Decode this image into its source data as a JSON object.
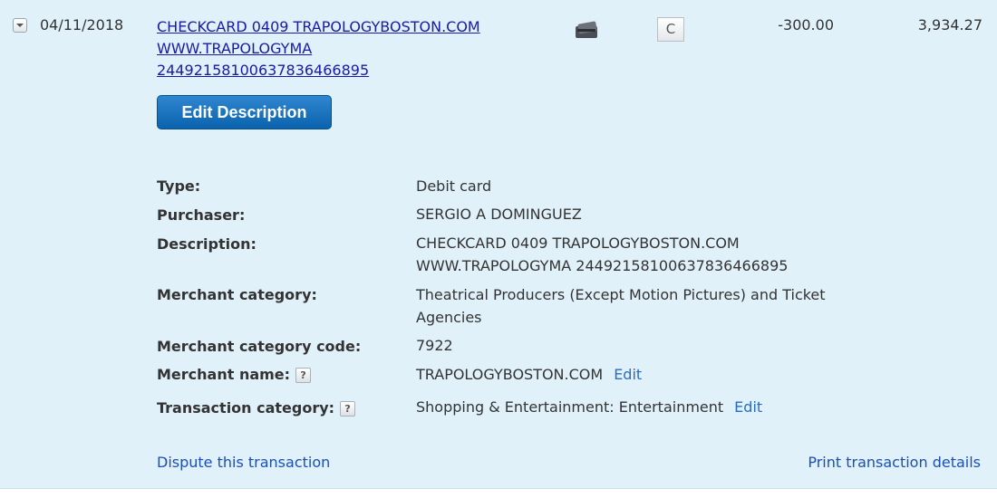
{
  "transaction": {
    "date": "04/11/2018",
    "description_lines": [
      "CHECKCARD 0409 TRAPOLOGYBOSTON.COM",
      "WWW.TRAPOLOGYMA",
      "24492158100637836466895"
    ],
    "status_letter": "C",
    "amount": "-300.00",
    "balance": "3,934.27",
    "card_icon": "debit-card-icon"
  },
  "actions": {
    "edit_description": "Edit Description",
    "dispute": "Dispute this transaction",
    "print": "Print transaction details"
  },
  "details": {
    "type_label": "Type:",
    "type_value": "Debit card",
    "purchaser_label": "Purchaser:",
    "purchaser_value": "SERGIO A DOMINGUEZ",
    "description_label": "Description:",
    "description_value_1": "CHECKCARD 0409 TRAPOLOGYBOSTON.COM",
    "description_value_2": "WWW.TRAPOLOGYMA 24492158100637836466895",
    "merchant_category_label": "Merchant category:",
    "merchant_category_value_1": "Theatrical Producers (Except Motion Pictures) and Ticket",
    "merchant_category_value_2": "Agencies",
    "merchant_code_label": "Merchant category code:",
    "merchant_code_value": "7922",
    "merchant_name_label": "Merchant name:",
    "merchant_name_value": "TRAPOLOGYBOSTON.COM",
    "merchant_name_edit": "Edit",
    "transaction_category_label": "Transaction category:",
    "transaction_category_value": "Shopping & Entertainment: Entertainment",
    "transaction_category_edit": "Edit",
    "help_glyph": "?"
  },
  "colors": {
    "panel_bg": "#e1f1fa",
    "link": "#1a1aa6",
    "button": "#0b62ad"
  }
}
